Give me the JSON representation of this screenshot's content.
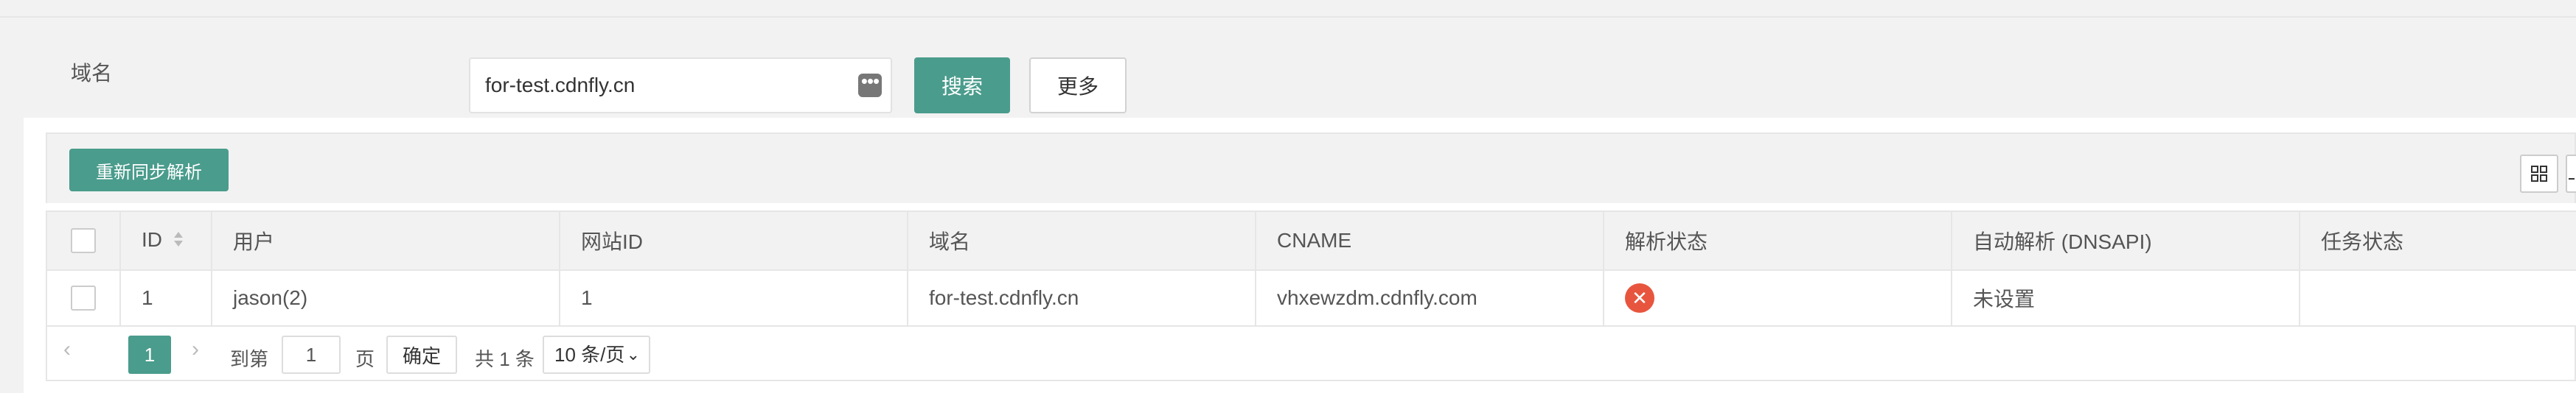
{
  "search": {
    "label": "域名",
    "value": "for-test.cdnfly.cn",
    "search_button": "搜索",
    "more_button": "更多"
  },
  "toolbar": {
    "resync_button": "重新同步解析",
    "columns_icon": "grid-columns-icon",
    "export_icon": "export-icon"
  },
  "table": {
    "headers": {
      "id": "ID",
      "user": "用户",
      "site_id": "网站ID",
      "domain": "域名",
      "cname": "CNAME",
      "resolve_status": "解析状态",
      "auto_resolve": "自动解析 (DNSAPI)",
      "task_status": "任务状态"
    },
    "rows": [
      {
        "id": "1",
        "user": "jason(2)",
        "site_id": "1",
        "domain": "for-test.cdnfly.cn",
        "cname": "vhxewzdm.cdnfly.com",
        "resolve_status_icon": "error-x-icon",
        "auto_resolve": "未设置",
        "task_status": ""
      }
    ]
  },
  "pager": {
    "current_page": "1",
    "goto_label": "到第",
    "goto_value": "1",
    "page_label": "页",
    "confirm_button": "确定",
    "total": "共 1 条",
    "page_size": "10 条/页"
  },
  "colors": {
    "accent": "#4a9c8c",
    "error": "#e8553e",
    "background": "#f2f2f2"
  }
}
